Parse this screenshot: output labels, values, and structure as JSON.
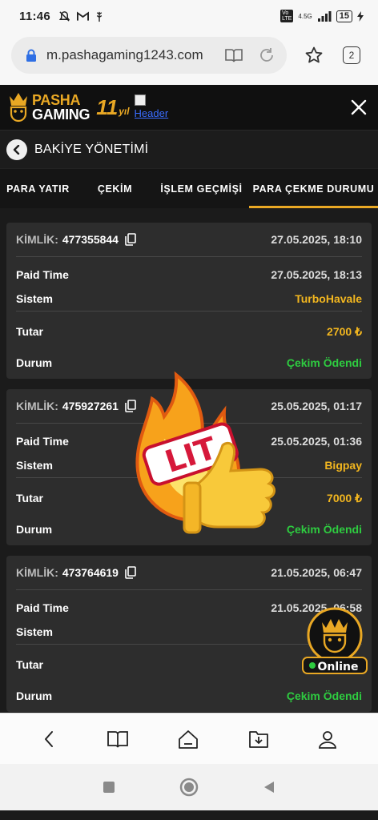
{
  "status_bar": {
    "time": "11:46",
    "network": "4.5G",
    "battery": "15"
  },
  "browser": {
    "url": "m.pashagaming1243.com",
    "tab_count": "2"
  },
  "header": {
    "brand_line1": "PASHA",
    "brand_line2": "GAMING",
    "anniversary": "11",
    "anniversary_suffix": "yıl",
    "broken_image_alt": "Header"
  },
  "page": {
    "title": "BAKİYE YÖNETİMİ"
  },
  "tabs": [
    {
      "label": "PARA YATIR",
      "active": false
    },
    {
      "label": "ÇEKİM",
      "active": false
    },
    {
      "label": "İŞLEM GEÇMİŞİ",
      "active": false
    },
    {
      "label": "PARA ÇEKME DURUMU",
      "active": true
    }
  ],
  "labels": {
    "id": "KİMLİK:",
    "paid_time": "Paid Time",
    "system": "Sistem",
    "amount": "Tutar",
    "status": "Durum"
  },
  "transactions": [
    {
      "id": "477355844",
      "created": "27.05.2025, 18:10",
      "paid_time": "27.05.2025, 18:13",
      "system": "TurboHavale",
      "amount": "2700 ₺",
      "status": "Çekim Ödendi"
    },
    {
      "id": "475927261",
      "created": "25.05.2025, 01:17",
      "paid_time": "25.05.2025, 01:36",
      "system": "Bigpay",
      "amount": "7000 ₺",
      "status": "Çekim Ödendi"
    },
    {
      "id": "473764619",
      "created": "21.05.2025, 06:47",
      "paid_time": "21.05.2025, 06:58",
      "system": "",
      "amount": "",
      "status": "Çekim Ödendi"
    }
  ],
  "sticker": {
    "text": "LIT"
  },
  "live_chat": {
    "label": "Online"
  },
  "colors": {
    "accent": "#e9a824",
    "amount": "#f2b61f",
    "success": "#2ecc40",
    "card": "#2d2d2d"
  }
}
